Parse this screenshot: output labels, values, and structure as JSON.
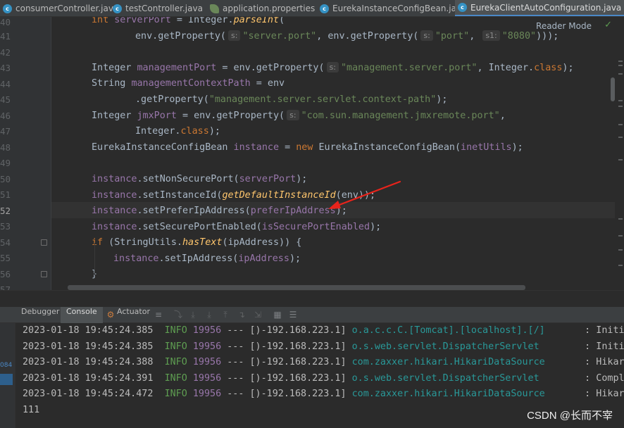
{
  "tabs": [
    {
      "label": "consumerController.java",
      "icon": "class-icon",
      "active": false
    },
    {
      "label": "testController.java",
      "icon": "class-icon",
      "active": false
    },
    {
      "label": "application.properties",
      "icon": "properties-icon",
      "active": false
    },
    {
      "label": "EurekaInstanceConfigBean.java",
      "icon": "locked-class-icon",
      "active": false
    },
    {
      "label": "EurekaClientAutoConfiguration.java",
      "icon": "locked-class-icon",
      "active": true
    }
  ],
  "editor": {
    "reader_mode": "Reader Mode",
    "line_numbers": [
      "40",
      "41",
      "42",
      "43",
      "44",
      "45",
      "46",
      "47",
      "48",
      "49",
      "50",
      "51",
      "52",
      "53",
      "54",
      "55",
      "56",
      "57"
    ],
    "hints": {
      "s1": "s:",
      "s2": "s:",
      "s3": "s1:",
      "s4": "s:",
      "s5": "s:"
    },
    "code": {
      "l40_a": "int",
      "l40_b": "serverPort",
      "l40_c": " = Integer.",
      "l40_d": "parseInt",
      "l40_e": "(",
      "l41_a": "env.getProperty(",
      "l41_b": "\"server.port\"",
      "l41_c": ", env.getProperty(",
      "l41_d": "\"port\"",
      "l41_e": ", ",
      "l41_f": "\"8080\"",
      "l41_g": ")));",
      "l43_a": "Integer ",
      "l43_b": "managementPort",
      "l43_c": " = env.getProperty(",
      "l43_d": "\"management.server.port\"",
      "l43_e": ", Integer.",
      "l43_f": "class",
      "l43_g": ");",
      "l44_a": "String ",
      "l44_b": "managementContextPath",
      "l44_c": " = env",
      "l45_a": ".getProperty(",
      "l45_b": "\"management.server.servlet.context-path\"",
      "l45_c": ");",
      "l46_a": "Integer ",
      "l46_b": "jmxPort",
      "l46_c": " = env.getProperty(",
      "l46_d": "\"com.sun.management.jmxremote.port\"",
      "l46_e": ",",
      "l47_a": "Integer.",
      "l47_b": "class",
      "l47_c": ");",
      "l48_a": "EurekaInstanceConfigBean ",
      "l48_b": "instance",
      "l48_c": " = ",
      "l48_d": "new",
      "l48_e": " EurekaInstanceConfigBean(",
      "l48_f": "inetUtils",
      "l48_g": ");",
      "l50_a": "instance",
      "l50_b": ".setNonSecurePort(",
      "l50_c": "serverPort",
      "l50_d": ");",
      "l51_a": "instance",
      "l51_b": ".setInstanceId(",
      "l51_c": "getDefaultInstanceId",
      "l51_d": "(env));",
      "l52_a": "instance",
      "l52_b": ".setPreferIpAddress(",
      "l52_c": "preferIpAddress",
      "l52_d": ");",
      "l53_a": "instance",
      "l53_b": ".setSecurePortEnabled(",
      "l53_c": "isSecurePortEnabled",
      "l53_d": ");",
      "l54_a": "if",
      "l54_b": " (StringUtils.",
      "l54_c": "hasText",
      "l54_d": "(ipAddress)) {",
      "l55_a": "instance",
      "l55_b": ".setIpAddress(",
      "l55_c": "ipAddress",
      "l55_d": ");",
      "l56_a": "}"
    }
  },
  "bottom_panel": {
    "tabs": [
      "Debugger",
      "Console",
      "Actuator"
    ],
    "active_tab": "Console",
    "left_badge": "084",
    "log": [
      {
        "time": "2023-01-18 19:45:24.385",
        "level": "INFO",
        "pid": "19956",
        "sep": "---",
        "thread": "[)-192.168.223.1]",
        "logger": "o.a.c.c.C.[Tomcat].[localhost].[/]",
        "message": ": Initializing"
      },
      {
        "time": "2023-01-18 19:45:24.385",
        "level": "INFO",
        "pid": "19956",
        "sep": "---",
        "thread": "[)-192.168.223.1]",
        "logger": "o.s.web.servlet.DispatcherServlet",
        "message": ": Initializing"
      },
      {
        "time": "2023-01-18 19:45:24.388",
        "level": "INFO",
        "pid": "19956",
        "sep": "---",
        "thread": "[)-192.168.223.1]",
        "logger": "com.zaxxer.hikari.HikariDataSource",
        "message": ": HikariPool-"
      },
      {
        "time": "2023-01-18 19:45:24.391",
        "level": "INFO",
        "pid": "19956",
        "sep": "---",
        "thread": "[)-192.168.223.1]",
        "logger": "o.s.web.servlet.DispatcherServlet",
        "message": ": Completed i"
      },
      {
        "time": "2023-01-18 19:45:24.472",
        "level": "INFO",
        "pid": "19956",
        "sep": "---",
        "thread": "[)-192.168.223.1]",
        "logger": "com.zaxxer.hikari.HikariDataSource",
        "message": ": HikariPool-"
      }
    ],
    "output": "111"
  },
  "watermark": "CSDN @长而不宰",
  "colors": {
    "keyword": "#cc7832",
    "field": "#9876aa",
    "string": "#6a8759",
    "method": "#ffc66d",
    "logger": "#299999",
    "info": "#5e9d51",
    "annotation_arrow": "#e8231b"
  }
}
